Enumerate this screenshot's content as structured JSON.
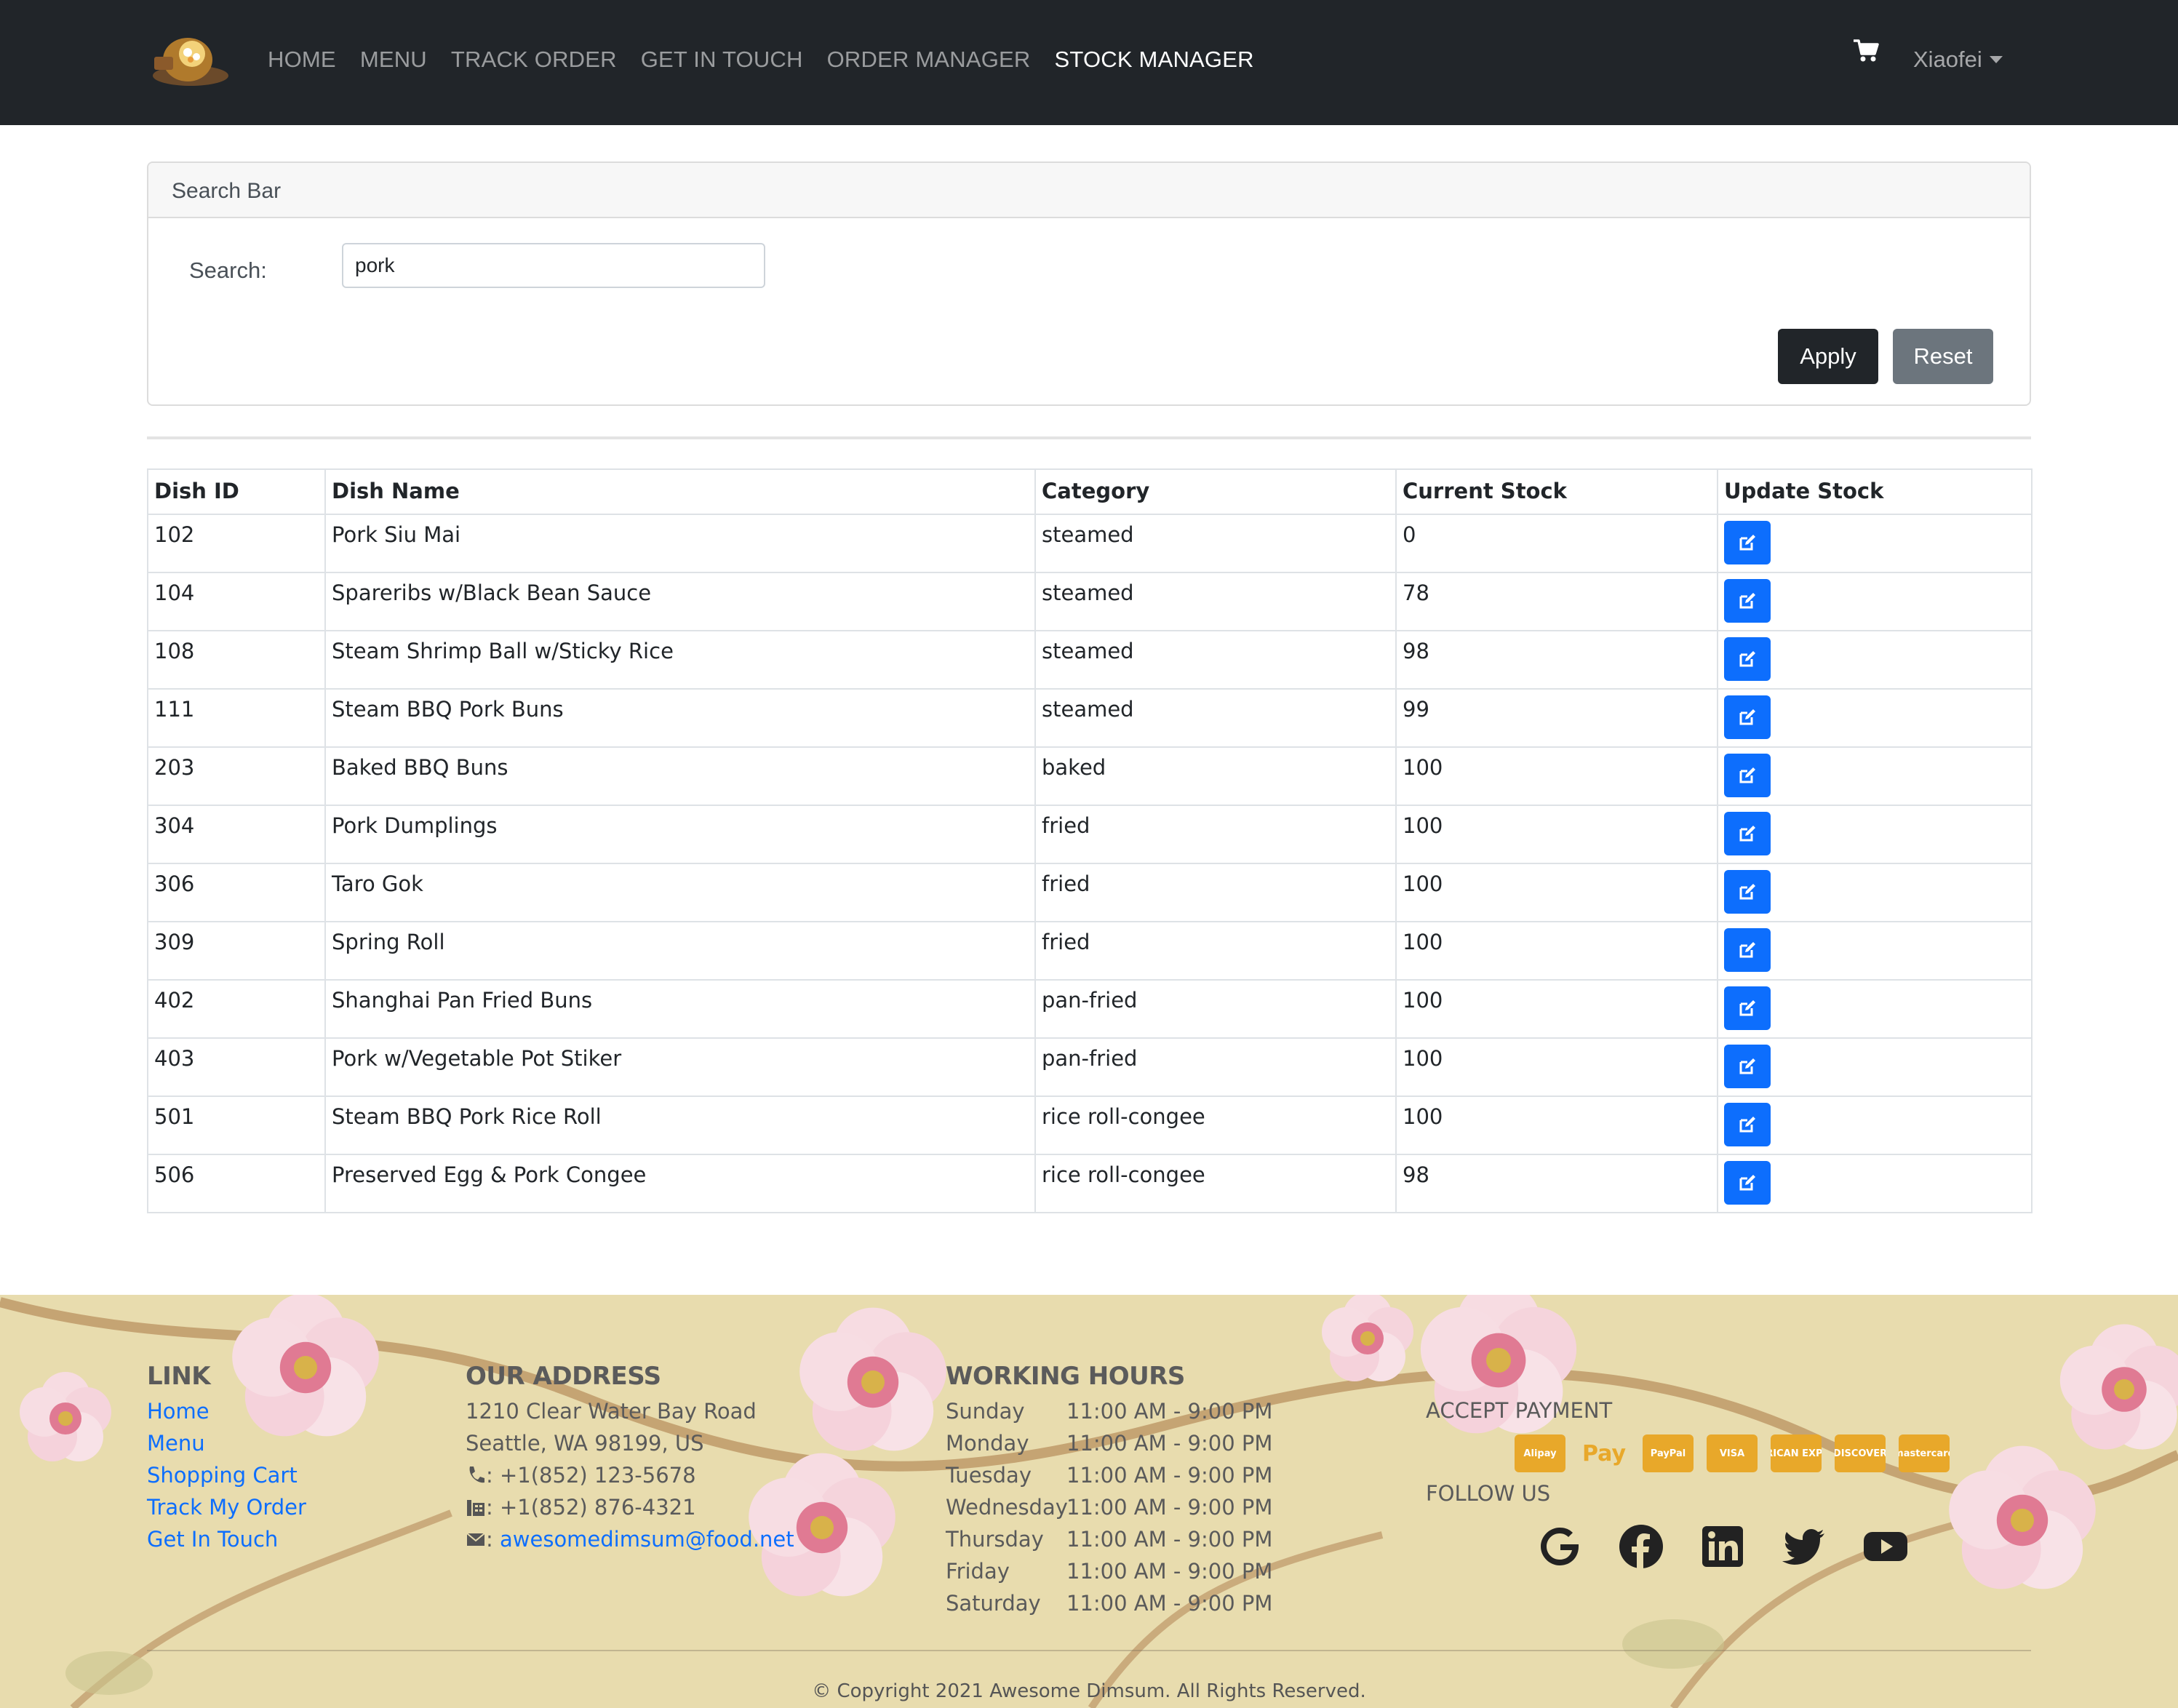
{
  "navbar": {
    "links": [
      "HOME",
      "MENU",
      "TRACK ORDER",
      "GET IN TOUCH",
      "ORDER MANAGER",
      "STOCK MANAGER"
    ],
    "active": "STOCK MANAGER",
    "user": "Xiaofei"
  },
  "search": {
    "header": "Search Bar",
    "label": "Search:",
    "value": "pork",
    "apply_label": "Apply",
    "reset_label": "Reset"
  },
  "table": {
    "columns": [
      "Dish ID",
      "Dish Name",
      "Category",
      "Current Stock",
      "Update Stock"
    ],
    "rows": [
      {
        "id": "102",
        "name": "Pork Siu Mai",
        "category": "steamed",
        "stock": "0"
      },
      {
        "id": "104",
        "name": "Spareribs w/Black Bean Sauce",
        "category": "steamed",
        "stock": "78"
      },
      {
        "id": "108",
        "name": "Steam Shrimp Ball w/Sticky Rice",
        "category": "steamed",
        "stock": "98"
      },
      {
        "id": "111",
        "name": "Steam BBQ Pork Buns",
        "category": "steamed",
        "stock": "99"
      },
      {
        "id": "203",
        "name": "Baked BBQ Buns",
        "category": "baked",
        "stock": "100"
      },
      {
        "id": "304",
        "name": "Pork Dumplings",
        "category": "fried",
        "stock": "100"
      },
      {
        "id": "306",
        "name": "Taro Gok",
        "category": "fried",
        "stock": "100"
      },
      {
        "id": "309",
        "name": "Spring Roll",
        "category": "fried",
        "stock": "100"
      },
      {
        "id": "402",
        "name": "Shanghai Pan Fried Buns",
        "category": "pan-fried",
        "stock": "100"
      },
      {
        "id": "403",
        "name": "Pork w/Vegetable Pot Stiker",
        "category": "pan-fried",
        "stock": "100"
      },
      {
        "id": "501",
        "name": "Steam BBQ Pork Rice Roll",
        "category": "rice roll-congee",
        "stock": "100"
      },
      {
        "id": "506",
        "name": "Preserved Egg & Pork Congee",
        "category": "rice roll-congee",
        "stock": "98"
      }
    ]
  },
  "footer": {
    "link": {
      "heading": "LINK",
      "items": [
        "Home",
        "Menu",
        "Shopping Cart",
        "Track My Order",
        "Get In Touch"
      ]
    },
    "address": {
      "heading": "OUR ADDRESS",
      "line1": "1210 Clear Water Bay Road",
      "line2": "Seattle, WA 98199, US",
      "phone": ": +1(852) 123-5678",
      "fax": ": +1(852) 876-4321",
      "email_prefix": ": ",
      "email": "awesomedimsum@food.net"
    },
    "hours": {
      "heading": "WORKING HOURS",
      "days": [
        {
          "day": "Sunday",
          "time": "11:00 AM - 9:00 PM"
        },
        {
          "day": "Monday",
          "time": "11:00 AM - 9:00 PM"
        },
        {
          "day": "Tuesday",
          "time": "11:00 AM - 9:00 PM"
        },
        {
          "day": "Wednesday",
          "time": "11:00 AM - 9:00 PM"
        },
        {
          "day": "Thursday",
          "time": "11:00 AM - 9:00 PM"
        },
        {
          "day": "Friday",
          "time": "11:00 AM - 9:00 PM"
        },
        {
          "day": "Saturday",
          "time": "11:00 AM - 9:00 PM"
        }
      ]
    },
    "payment": {
      "heading": "ACCEPT PAYMENT",
      "methods": [
        "Alipay",
        "Pay",
        "PayPal",
        "VISA",
        "AMERICAN EXPRESS",
        "DISCOVER",
        "mastercard"
      ]
    },
    "follow": {
      "heading": "FOLLOW US",
      "icons": [
        "google-icon",
        "facebook-icon",
        "linkedin-icon",
        "twitter-icon",
        "youtube-icon"
      ]
    },
    "copyright": "© Copyright 2021 Awesome Dimsum. All Rights Reserved."
  },
  "colors": {
    "navbar_bg": "#212529",
    "primary": "#0d6efd",
    "apply": "#212529",
    "reset": "#6c757d",
    "payment_badge": "#e8a82a",
    "footer_bg": "#e8dcae"
  }
}
